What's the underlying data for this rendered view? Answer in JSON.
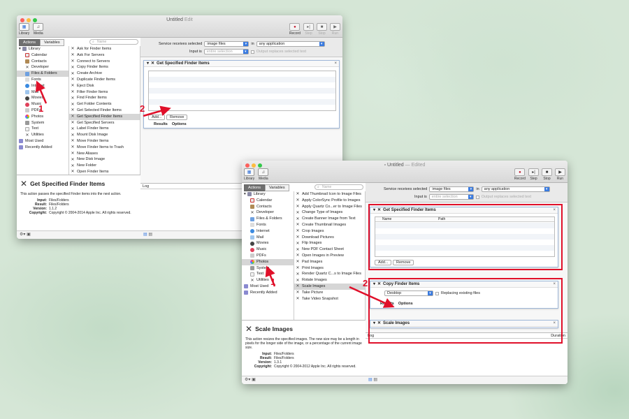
{
  "colors": {
    "accent": "#e0102a",
    "selection_blue": "#3a7be0",
    "background_green": "#d5e6d6"
  },
  "window1": {
    "title": "Untitled",
    "title_suffix": "Edit",
    "toolbar": {
      "library": "Library",
      "media": "Media",
      "record": "Record",
      "step": "Step",
      "stop": "Stop",
      "run": "Run"
    },
    "tabs": {
      "actions": "Actions",
      "variables": "Variables"
    },
    "search_placeholder": "Name",
    "library_root": "Library",
    "library_items": [
      "Calendar",
      "Contacts",
      "Developer",
      "Files & Folders",
      "Fonts",
      "Internet",
      "Mail",
      "Movies",
      "Music",
      "PDFs",
      "Photos",
      "System",
      "Text",
      "Utilities"
    ],
    "library_extra": [
      "Most Used",
      "Recently Added"
    ],
    "actions": [
      "Ask for Finder Items",
      "Ask For Servers",
      "Connect to Servers",
      "Copy Finder Items",
      "Create Archive",
      "Duplicate Finder Items",
      "Eject Disk",
      "Filter Finder Items",
      "Find Finder Items",
      "Get Folder Contents",
      "Get Selected Finder Items",
      "Get Specified Finder Items",
      "Get Specified Servers",
      "Label Finder Items",
      "Mount Disk Image",
      "Move Finder Items",
      "Move Finder Items to Trash",
      "New Aliases",
      "New Disk Image",
      "New Folder",
      "Open Finder Items"
    ],
    "receives_label": "Service receives selected",
    "receives_value": "image files",
    "in_label": "in",
    "in_value": "any application",
    "input_label": "Input is",
    "input_value": "entire selection",
    "output_label": "Output replaces selected text",
    "card_title": "Get Specified Finder Items",
    "add_button": "Add...",
    "remove_button": "Remove",
    "results_tab": "Results",
    "options_tab": "Options",
    "info": {
      "title": "Get Specified Finder Items",
      "desc": "This action passes the specified Finder items into the next action.",
      "input_k": "Input:",
      "input_v": "Files/Folders",
      "result_k": "Result:",
      "result_v": "Files/Folders",
      "version_k": "Version:",
      "version_v": "1.1.2",
      "copyright_k": "Copyright:",
      "copyright_v": "Copyright © 2004-2014 Apple Inc.  All rights reserved."
    },
    "log_label": "Log",
    "anno_1": "1",
    "anno_2": "2"
  },
  "window2": {
    "title": "Untitled",
    "title_suffix": "— Edited",
    "toolbar": {
      "library": "Library",
      "media": "Media",
      "record": "Record",
      "step": "Step",
      "stop": "Stop",
      "run": "Run"
    },
    "tabs": {
      "actions": "Actions",
      "variables": "Variables"
    },
    "search_placeholder": "Name",
    "library_root": "Library",
    "library_items": [
      "Calendar",
      "Contacts",
      "Developer",
      "Files & Folders",
      "Fonts",
      "Internet",
      "Mail",
      "Movies",
      "Music",
      "PDFs",
      "Photos",
      "System",
      "Text",
      "Utilities"
    ],
    "library_extra": [
      "Most Used",
      "Recently Added"
    ],
    "actions": [
      "Add Thumbnail Icon to Image Files",
      "Apply ColorSync Profile to Images",
      "Apply Quartz Co...er to Image Files",
      "Change Type of Images",
      "Create Banner Image from Text",
      "Create Thumbnail Images",
      "Crop Images",
      "Download Pictures",
      "Flip Images",
      "New PDF Contact Sheet",
      "Open Images in Preview",
      "Pad Images",
      "Print Images",
      "Render Quartz C...s to Image Files",
      "Rotate Images",
      "Scale Images",
      "Take Picture",
      "Take Video Snapshot"
    ],
    "receives_label": "Service receives selected",
    "receives_value": "image files",
    "in_label": "in",
    "in_value": "any application",
    "input_label": "Input is",
    "input_value": "entire selection",
    "output_label": "Output replaces selected text",
    "card1_title": "Get Specified Finder Items",
    "col_name": "Name",
    "col_path": "Path",
    "add_button": "Add...",
    "remove_button": "Remove",
    "results_tab": "Results",
    "options_tab": "Options",
    "card2_title": "Copy Finder Items",
    "to_value": "Desktop",
    "replacing_label": "Replacing existing files",
    "card3_title": "Scale Images",
    "log_label": "Log",
    "duration_label": "Duration",
    "info": {
      "title": "Scale Images",
      "desc": "This action resizes the specified images. The new size may be a length in pixels for the longer side of the image, or a percentage of the current image size.",
      "input_k": "Input:",
      "input_v": "Files/Folders",
      "result_k": "Result:",
      "result_v": "Files/Folders",
      "version_k": "Version:",
      "version_v": "1.3.1",
      "copyright_k": "Copyright:",
      "copyright_v": "Copyright © 2004-2012 Apple Inc.  All rights reserved."
    },
    "anno_1": "1",
    "anno_2": "2"
  }
}
